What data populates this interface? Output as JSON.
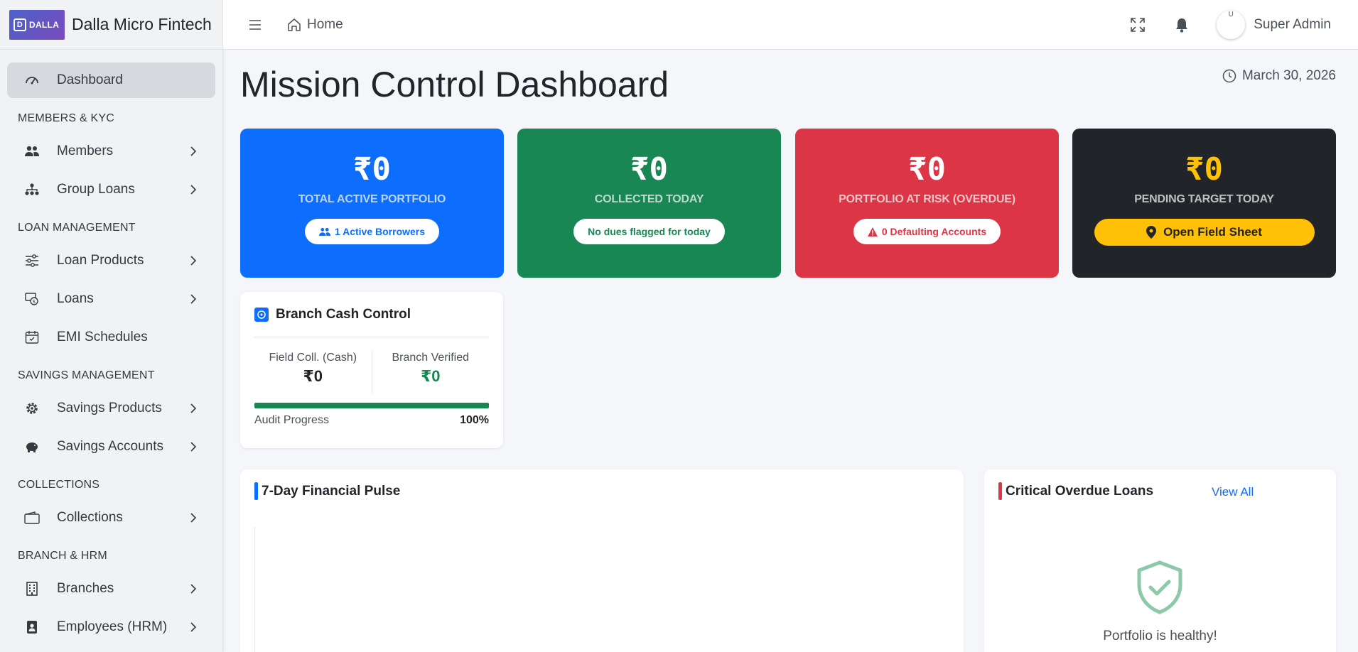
{
  "brand": {
    "logo_text": "DALLA",
    "name": "Dalla Micro Fintech"
  },
  "sidebar": {
    "dashboard": "Dashboard",
    "sections": {
      "members_kyc": "MEMBERS & KYC",
      "loan_management": "LOAN MANAGEMENT",
      "savings_management": "SAVINGS MANAGEMENT",
      "collections": "COLLECTIONS",
      "branch_hrm": "BRANCH & HRM"
    },
    "items": {
      "members": "Members",
      "group_loans": "Group Loans",
      "loan_products": "Loan Products",
      "loans": "Loans",
      "emi_schedules": "EMI Schedules",
      "savings_products": "Savings Products",
      "savings_accounts": "Savings Accounts",
      "collections": "Collections",
      "branches": "Branches",
      "employees": "Employees (HRM)"
    }
  },
  "topbar": {
    "home": "Home",
    "user": "Super Admin",
    "avatar_alt": "U"
  },
  "page": {
    "title": "Mission Control Dashboard",
    "date": "March 30, 2026"
  },
  "stats": {
    "portfolio": {
      "value": "₹0",
      "label": "TOTAL ACTIVE PORTFOLIO",
      "badge": "1 Active Borrowers",
      "color": "#0d6efd"
    },
    "collected": {
      "value": "₹0",
      "label": "COLLECTED TODAY",
      "badge": "No dues flagged for today",
      "color": "#198754"
    },
    "risk": {
      "value": "₹0",
      "label": "PORTFOLIO AT RISK (OVERDUE)",
      "badge": "0 Defaulting Accounts",
      "color": "#dc3545"
    },
    "pending": {
      "value": "₹0",
      "label": "PENDING TARGET TODAY",
      "button": "Open Field Sheet",
      "color": "#212529"
    }
  },
  "cash_control": {
    "title": "Branch Cash Control",
    "field_label": "Field Coll. (Cash)",
    "field_value": "₹0",
    "verified_label": "Branch Verified",
    "verified_value": "₹0",
    "audit_label": "Audit Progress",
    "audit_percent": "100%",
    "audit_progress": 100
  },
  "pulse": {
    "title": "7-Day Financial Pulse"
  },
  "overdue": {
    "title": "Critical Overdue Loans",
    "view_all": "View All",
    "healthy": "Portfolio is healthy!"
  }
}
